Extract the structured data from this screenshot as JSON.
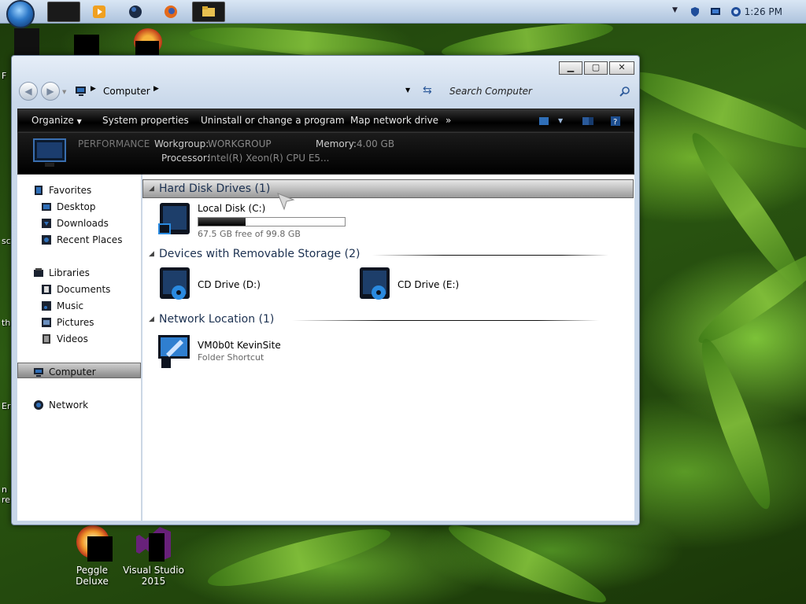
{
  "taskbar": {
    "clock": "1:26 PM",
    "icons": [
      "start-orb",
      "media-player-icon",
      "circle-app-icon",
      "firefox-icon",
      "explorer-icon"
    ]
  },
  "desktop": {
    "icons": [
      {
        "label": "Peggle Deluxe"
      },
      {
        "label": "Visual Studio\n2015"
      }
    ],
    "edge_text": [
      "F",
      "sc",
      "th",
      "Er",
      "n\nre"
    ]
  },
  "window": {
    "address": {
      "location": "Computer"
    },
    "search": {
      "placeholder": "Search Computer"
    },
    "caption": {
      "minimize": "▁",
      "maximize": "▢",
      "close": "✕"
    },
    "commands": [
      {
        "label": "Organize"
      },
      {
        "label": "System properties"
      },
      {
        "label": "Uninstall or change a program"
      },
      {
        "label": "Map network drive"
      },
      {
        "label": "»"
      }
    ],
    "details": {
      "performance": "PERFORMANCE",
      "workgroup_label": "Workgroup:",
      "workgroup_value": "WORKGROUP",
      "memory_label": "Memory:",
      "memory_value": "4.00 GB",
      "processor_label": "Processor:",
      "processor_value": "Intel(R) Xeon(R) CPU E5..."
    },
    "nav": {
      "favorites": "Favorites",
      "desktop": "Desktop",
      "downloads": "Downloads",
      "recent": "Recent Places",
      "libraries": "Libraries",
      "documents": "Documents",
      "music": "Music",
      "pictures": "Pictures",
      "videos": "Videos",
      "computer": "Computer",
      "network": "Network"
    },
    "groups": {
      "hdd": {
        "title": "Hard Disk Drives (1)",
        "items": [
          {
            "name": "Local Disk (C:)",
            "sub": "67.5 GB free of 99.8 GB",
            "used_fraction": 0.32
          }
        ]
      },
      "removable": {
        "title": "Devices with Removable Storage (2)",
        "items": [
          {
            "name": "CD Drive (D:)"
          },
          {
            "name": "CD Drive (E:)"
          }
        ]
      },
      "network": {
        "title": "Network Location (1)",
        "items": [
          {
            "name": "VM0b0t KevinSite",
            "sub": "Folder Shortcut"
          }
        ]
      }
    }
  },
  "colors": {
    "accent": "#1f78d1",
    "taskbar_top": "#d9e6f4",
    "command_bar": "#000000"
  }
}
